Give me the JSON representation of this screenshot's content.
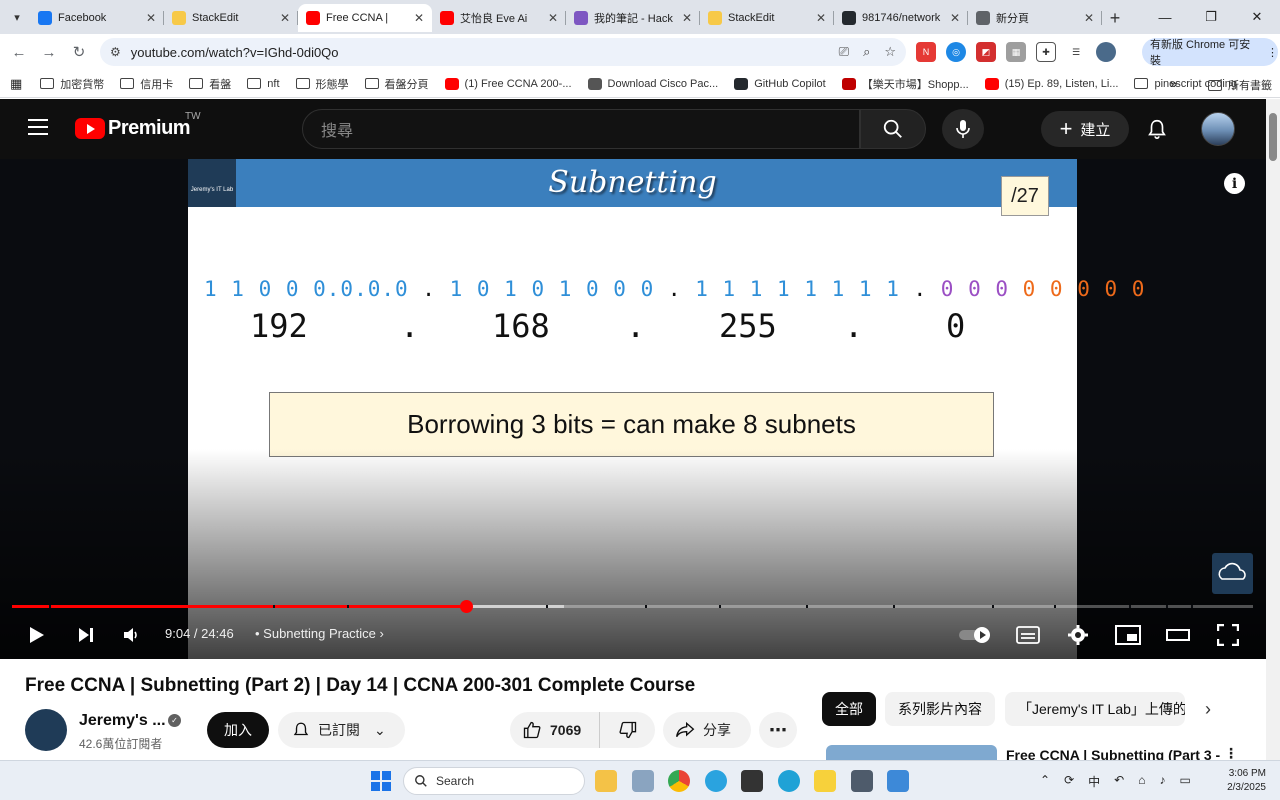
{
  "browser": {
    "tabs": [
      {
        "title": "Facebook",
        "favicon": "facebook-icon",
        "color": "#1877f2",
        "active": false
      },
      {
        "title": "StackEdit",
        "favicon": "stackedit-icon",
        "color": "#f7c948",
        "active": false
      },
      {
        "title": "Free CCNA |",
        "favicon": "youtube-icon",
        "color": "#ff0000",
        "active": true
      },
      {
        "title": "艾怡良 Eve Ai",
        "favicon": "youtube-icon",
        "color": "#ff0000",
        "active": false
      },
      {
        "title": "我的筆記 - Hack",
        "favicon": "hackmd-icon",
        "color": "#7e57c2",
        "active": false
      },
      {
        "title": "StackEdit",
        "favicon": "stackedit-icon",
        "color": "#f7c948",
        "active": false
      },
      {
        "title": "981746/network",
        "favicon": "github-icon",
        "color": "#24292e",
        "active": false
      },
      {
        "title": "新分頁",
        "favicon": "chrome-icon",
        "color": "#5f6368",
        "active": false
      }
    ],
    "url": "youtube.com/watch?v=IGhd-0di0Qo",
    "update_label": "有新版 Chrome 可安裝",
    "bookmarks": [
      {
        "label": "加密貨幣",
        "type": "folder"
      },
      {
        "label": "信用卡",
        "type": "folder"
      },
      {
        "label": "看盤",
        "type": "folder"
      },
      {
        "label": "nft",
        "type": "folder"
      },
      {
        "label": "形態學",
        "type": "folder"
      },
      {
        "label": "看盤分頁",
        "type": "folder"
      },
      {
        "label": "(1) Free CCNA 200-...",
        "type": "youtube"
      },
      {
        "label": "Download Cisco Pac...",
        "type": "link"
      },
      {
        "label": "GitHub Copilot",
        "type": "github"
      },
      {
        "label": "【樂天市場】Shopp...",
        "type": "rakuten"
      },
      {
        "label": "(15) Ep. 89, Listen, Li...",
        "type": "youtube"
      },
      {
        "label": "pinescript coding",
        "type": "folder"
      }
    ],
    "bookmarks_overflow": "»",
    "all_bookmarks": "所有書籤"
  },
  "youtube": {
    "logo_text": "Premium",
    "region": "TW",
    "search_placeholder": "搜尋",
    "create_label": "建立",
    "player": {
      "slide_title": "Subnetting",
      "slide_logo_text": "Jeremy's IT Lab",
      "prefix": "/27",
      "bit_groups": [
        {
          "text": "1 1 0 0 0.0.0.0",
          "color": "#2f8fd8"
        },
        {
          "text": " . ",
          "color": "#111111"
        },
        {
          "text": "1 0 1 0 1 0 0 0",
          "color": "#2f8fd8"
        },
        {
          "text": " . ",
          "color": "#111111"
        },
        {
          "text": "1 1 1 1 1 1 1 1",
          "color": "#2f8fd8"
        },
        {
          "text": " . ",
          "color": "#111111"
        },
        {
          "text": "0 0 0 ",
          "color": "#9b4fc4"
        },
        {
          "text": "0 0 0 0 0",
          "color": "#ee6a1a"
        }
      ],
      "octets": [
        "192",
        "168",
        "255",
        "0"
      ],
      "octet_sep": ".",
      "callout": "Borrowing 3 bits = can make 8 subnets",
      "time_current": "9:04",
      "time_total": "24:46",
      "time_display": "9:04 / 24:46",
      "chapter": "Subnetting Practice",
      "progress_fraction": 0.366,
      "buffered_fraction": 0.445
    },
    "video": {
      "title": "Free CCNA | Subnetting (Part 2) | Day 14 | CCNA 200-301 Complete Course",
      "channel": "Jeremy's ...",
      "subscribers": "42.6萬位訂閱者",
      "join_label": "加入",
      "subscribed_label": "已訂閱",
      "likes": "7069",
      "share_label": "分享"
    },
    "chips": [
      "全部",
      "系列影片內容",
      "「Jeremy's IT Lab」上傳的"
    ],
    "related_title": "Free CCNA | Subnetting (Part 3 -"
  },
  "taskbar": {
    "search_label": "Search",
    "ime": "中",
    "time": "3:06 PM",
    "date": "2/3/2025"
  }
}
